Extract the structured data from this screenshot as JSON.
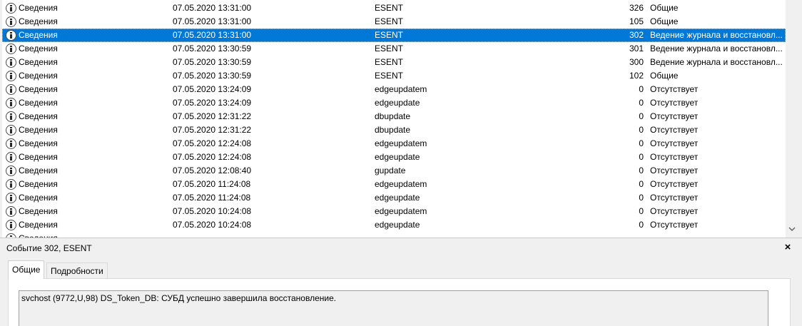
{
  "events": [
    {
      "level": "Сведения",
      "date": "07.05.2020 13:31:00",
      "source": "ESENT",
      "event_id": "326",
      "category": "Общие",
      "selected": false
    },
    {
      "level": "Сведения",
      "date": "07.05.2020 13:31:00",
      "source": "ESENT",
      "event_id": "105",
      "category": "Общие",
      "selected": false
    },
    {
      "level": "Сведения",
      "date": "07.05.2020 13:31:00",
      "source": "ESENT",
      "event_id": "302",
      "category": "Ведение журнала и восстановл...",
      "selected": true
    },
    {
      "level": "Сведения",
      "date": "07.05.2020 13:30:59",
      "source": "ESENT",
      "event_id": "301",
      "category": "Ведение журнала и восстановл...",
      "selected": false
    },
    {
      "level": "Сведения",
      "date": "07.05.2020 13:30:59",
      "source": "ESENT",
      "event_id": "300",
      "category": "Ведение журнала и восстановл...",
      "selected": false
    },
    {
      "level": "Сведения",
      "date": "07.05.2020 13:30:59",
      "source": "ESENT",
      "event_id": "102",
      "category": "Общие",
      "selected": false
    },
    {
      "level": "Сведения",
      "date": "07.05.2020 13:24:09",
      "source": "edgeupdatem",
      "event_id": "0",
      "category": "Отсутствует",
      "selected": false
    },
    {
      "level": "Сведения",
      "date": "07.05.2020 13:24:09",
      "source": "edgeupdate",
      "event_id": "0",
      "category": "Отсутствует",
      "selected": false
    },
    {
      "level": "Сведения",
      "date": "07.05.2020 12:31:22",
      "source": "dbupdate",
      "event_id": "0",
      "category": "Отсутствует",
      "selected": false
    },
    {
      "level": "Сведения",
      "date": "07.05.2020 12:31:22",
      "source": "dbupdate",
      "event_id": "0",
      "category": "Отсутствует",
      "selected": false
    },
    {
      "level": "Сведения",
      "date": "07.05.2020 12:24:08",
      "source": "edgeupdatem",
      "event_id": "0",
      "category": "Отсутствует",
      "selected": false
    },
    {
      "level": "Сведения",
      "date": "07.05.2020 12:24:08",
      "source": "edgeupdate",
      "event_id": "0",
      "category": "Отсутствует",
      "selected": false
    },
    {
      "level": "Сведения",
      "date": "07.05.2020 12:08:40",
      "source": "gupdate",
      "event_id": "0",
      "category": "Отсутствует",
      "selected": false
    },
    {
      "level": "Сведения",
      "date": "07.05.2020 11:24:08",
      "source": "edgeupdatem",
      "event_id": "0",
      "category": "Отсутствует",
      "selected": false
    },
    {
      "level": "Сведения",
      "date": "07.05.2020 11:24:08",
      "source": "edgeupdate",
      "event_id": "0",
      "category": "Отсутствует",
      "selected": false
    },
    {
      "level": "Сведения",
      "date": "07.05.2020 10:24:08",
      "source": "edgeupdatem",
      "event_id": "0",
      "category": "Отсутствует",
      "selected": false
    },
    {
      "level": "Сведения",
      "date": "07.05.2020 10:24:08",
      "source": "edgeupdate",
      "event_id": "0",
      "category": "Отсутствует",
      "selected": false
    },
    {
      "level": "Сведения",
      "date": "",
      "source": "",
      "event_id": "",
      "category": "",
      "selected": false
    }
  ],
  "icons": {
    "info": "info-icon",
    "scroll_down": "chevron-down-icon",
    "close": "close-icon"
  },
  "colors": {
    "selection": "#0078d7",
    "pane_background": "#f0f0f0"
  },
  "details": {
    "title": "Событие 302, ESENT",
    "close_glyph": "×",
    "tabs": [
      {
        "label": "Общие",
        "active": true
      },
      {
        "label": "Подробности",
        "active": false
      }
    ],
    "message": "svchost (9772,U,98) DS_Token_DB: СУБД успешно завершила восстановление."
  }
}
